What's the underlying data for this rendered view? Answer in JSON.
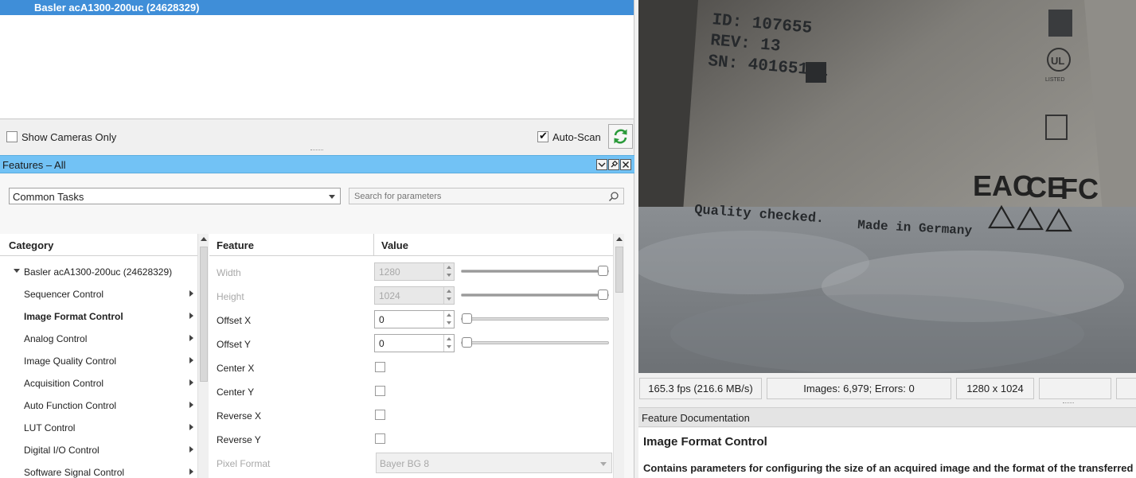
{
  "device_list": {
    "selected_device": "Basler acA1300-200uc (24628329)"
  },
  "device_toolbar": {
    "show_cameras_only_label": "Show Cameras Only",
    "show_cameras_only_checked": false,
    "auto_scan_label": "Auto-Scan",
    "auto_scan_checked": true,
    "refresh_icon": "refresh-icon"
  },
  "features_panel": {
    "title": "Features – All",
    "task_select": {
      "selected": "Common Tasks"
    },
    "search": {
      "placeholder": "Search for parameters"
    },
    "category_header": "Category",
    "feature_header": "Feature",
    "value_header": "Value",
    "categories": {
      "root": "Basler acA1300-200uc (24628329)",
      "items": [
        "Sequencer Control",
        "Image Format Control",
        "Analog Control",
        "Image Quality Control",
        "Acquisition Control",
        "Auto Function Control",
        "LUT Control",
        "Digital I/O Control",
        "Software Signal Control"
      ],
      "selected": "Image Format Control"
    },
    "features": {
      "width": {
        "name": "Width",
        "value": "1280",
        "enabled": false,
        "slider_fraction": 1.0
      },
      "height": {
        "name": "Height",
        "value": "1024",
        "enabled": false,
        "slider_fraction": 1.0
      },
      "offset_x": {
        "name": "Offset X",
        "value": "0",
        "enabled": true,
        "slider_fraction": 0.0
      },
      "offset_y": {
        "name": "Offset Y",
        "value": "0",
        "enabled": true,
        "slider_fraction": 0.0
      },
      "center_x": {
        "name": "Center X",
        "checked": false
      },
      "center_y": {
        "name": "Center Y",
        "checked": false
      },
      "reverse_x": {
        "name": "Reverse X",
        "checked": false
      },
      "reverse_y": {
        "name": "Reverse Y",
        "checked": false
      },
      "pixel_format": {
        "name": "Pixel Format",
        "value": "Bayer BG 8",
        "enabled": false
      }
    }
  },
  "camera_image": {
    "label_lines": [
      "ID: 107655",
      "REV: 13",
      "SN: 40165161"
    ],
    "quality_text": "Quality checked.",
    "made_in_text": "Made in Germany",
    "marks": [
      "EAC",
      "CE",
      "FC"
    ],
    "ul_text": "UL",
    "ul_listed": "LISTED"
  },
  "status_bar": {
    "fps": "165.3 fps (216.6 MB/s)",
    "images": "Images: 6,979; Errors: 0",
    "resolution": "1280 x 1024"
  },
  "documentation": {
    "header": "Feature Documentation",
    "title": "Image Format Control",
    "text": "Contains parameters for configuring the size of an acquired image and the format of the transferred pixel data."
  },
  "colors": {
    "selection_blue": "#3f8ed8",
    "panel_header_blue": "#72c2f5",
    "refresh_green": "#2a9a3a"
  }
}
